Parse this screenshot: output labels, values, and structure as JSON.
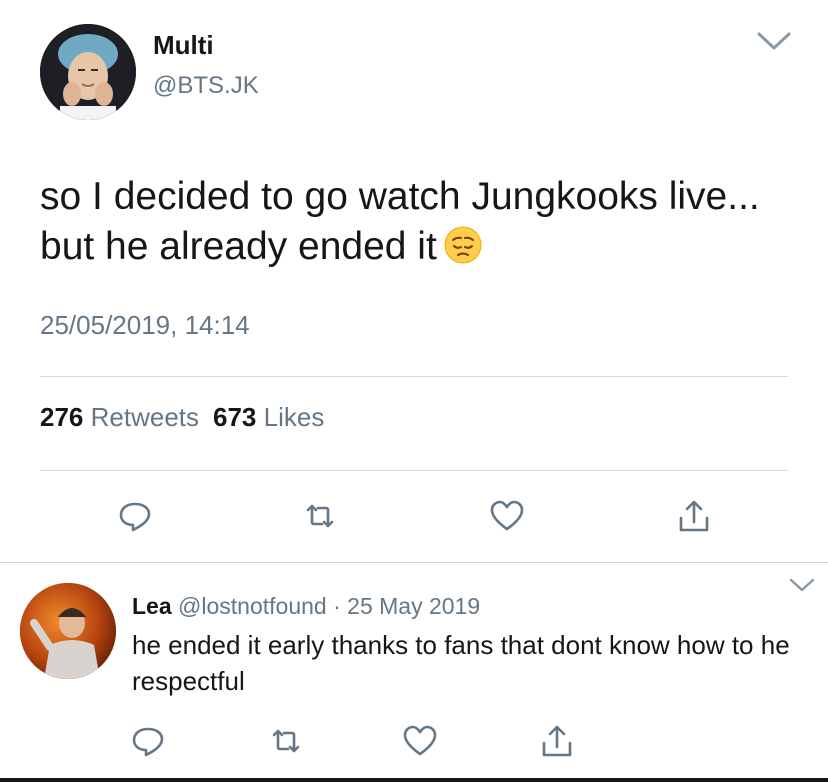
{
  "tweet": {
    "display_name": "Multi",
    "handle": "@BTS.JK",
    "text": "so I decided to go watch Jungkooks live... but he already ended it",
    "emoji": "pensive-face",
    "timestamp": "25/05/2019, 14:14",
    "stats": {
      "retweets_count": "276",
      "retweets_label": "Retweets",
      "likes_count": "673",
      "likes_label": "Likes"
    },
    "actions": [
      "reply-icon",
      "retweet-icon",
      "like-icon",
      "share-icon"
    ]
  },
  "reply": {
    "display_name": "Lea",
    "handle": "@lostnotfound",
    "separator": "·",
    "date": "25 May 2019",
    "text": "he ended it early thanks to fans that dont know how to he respectful",
    "actions": [
      "reply-icon",
      "retweet-icon",
      "like-icon",
      "share-icon"
    ]
  },
  "colors": {
    "primary_text": "#14171a",
    "secondary_text": "#657786",
    "divider": "#d6d9dc",
    "icon": "#657786"
  }
}
